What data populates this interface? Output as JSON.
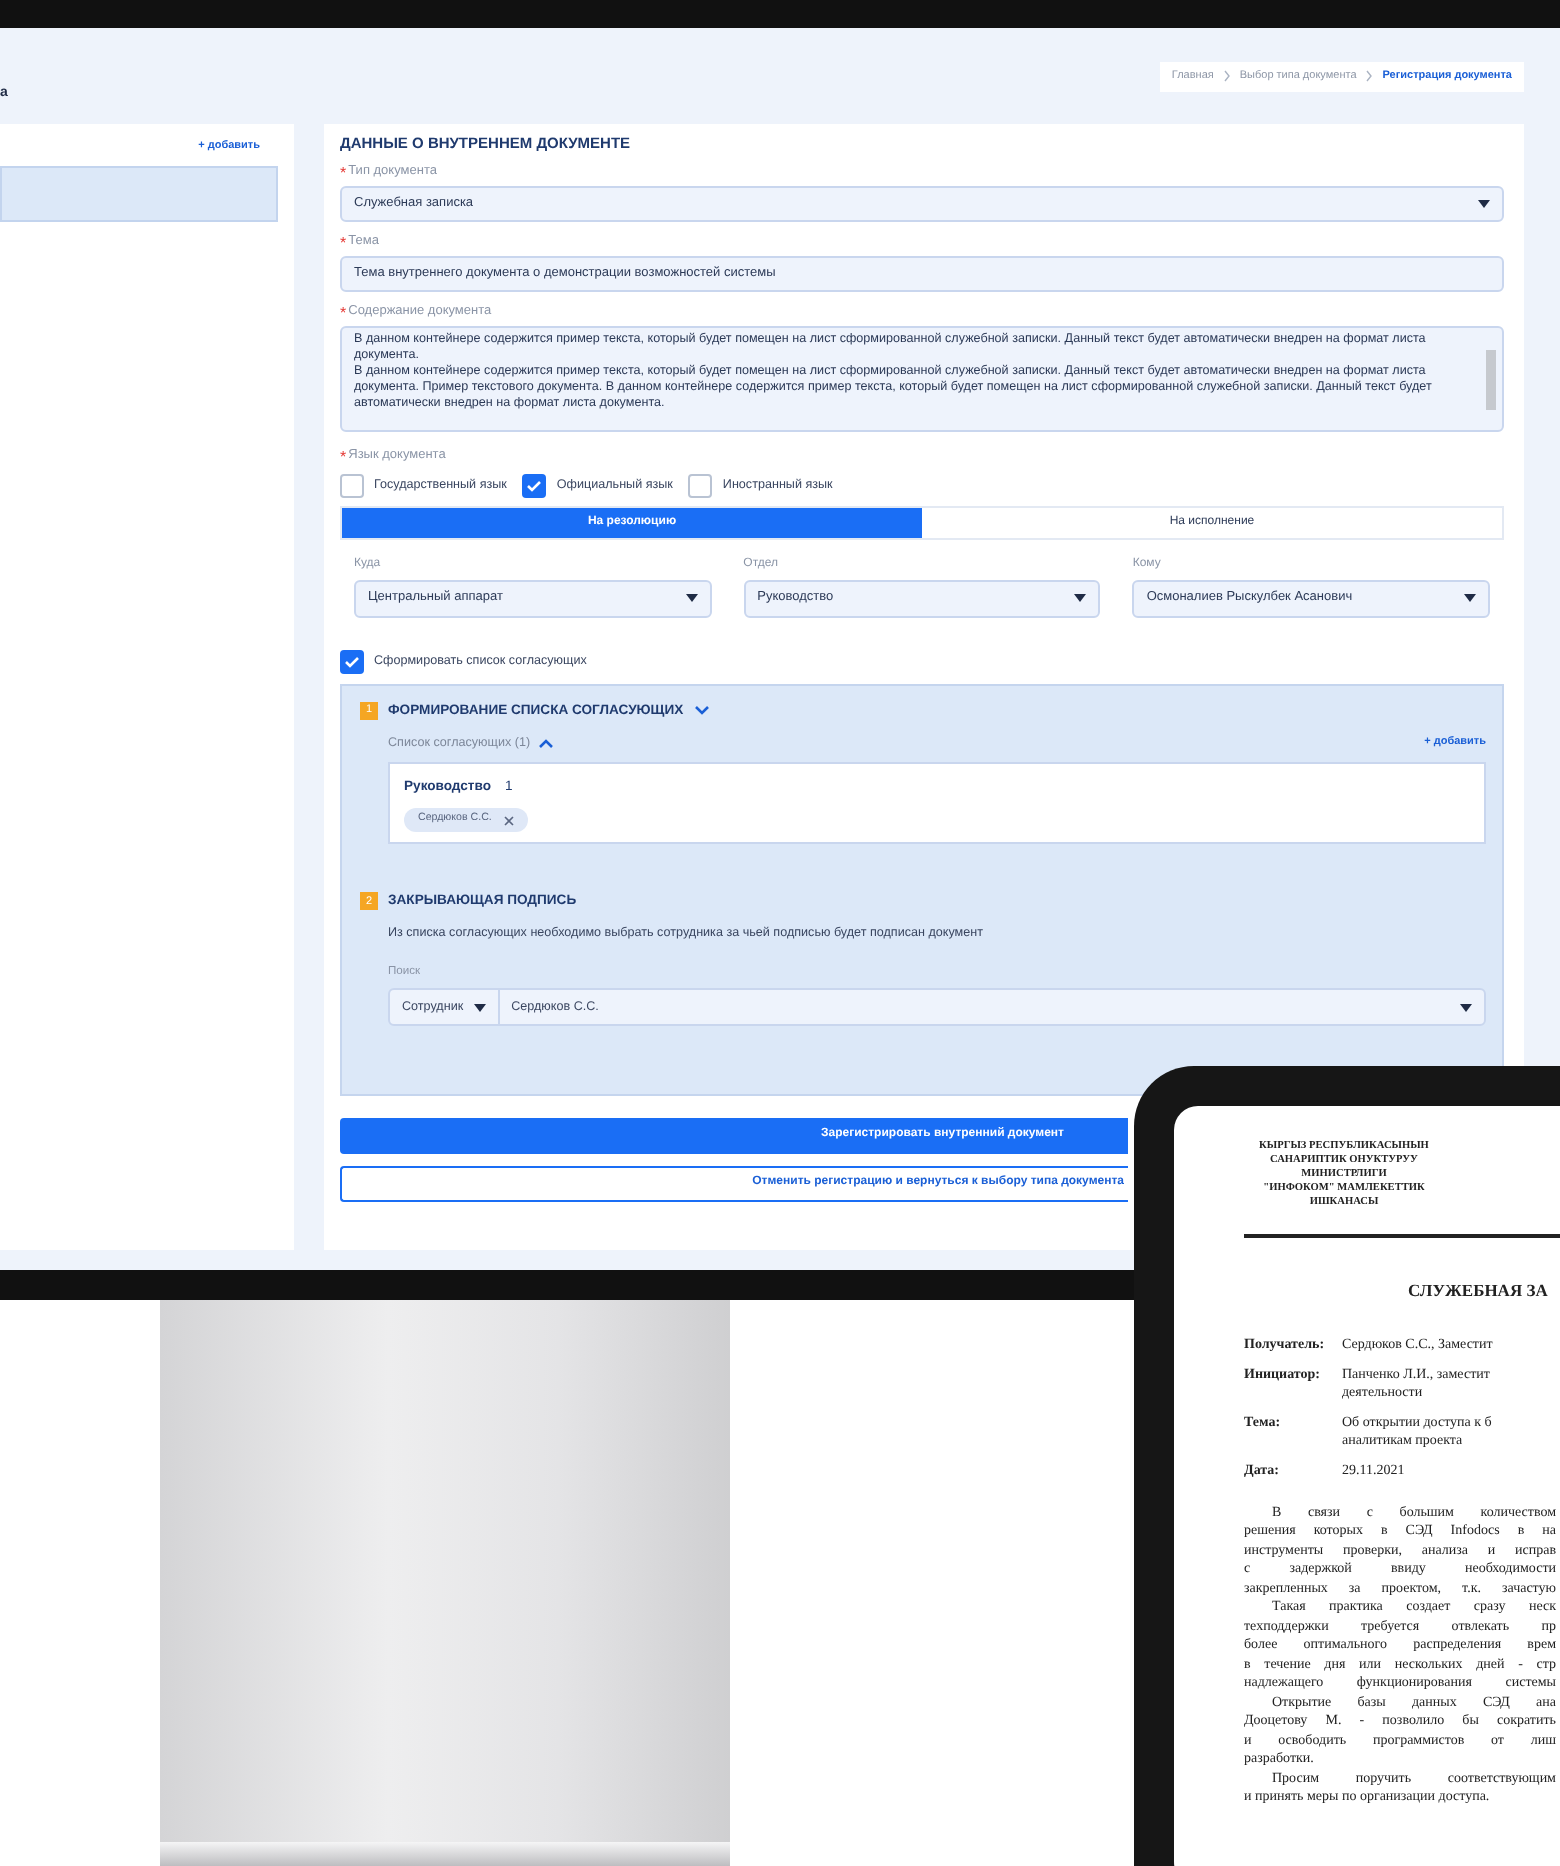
{
  "header": {
    "cut_title": "а",
    "breadcrumbs": [
      {
        "label": "Главная",
        "selected": false
      },
      {
        "label": "Выбор типа документа",
        "selected": false
      },
      {
        "label": "Регистрация документа",
        "selected": true
      }
    ]
  },
  "sidebar": {
    "add_link": "+ добавить",
    "items": [
      {
        "selected": true
      }
    ]
  },
  "form": {
    "title": "ДАННЫЕ О ВНУТРЕННЕМ ДОКУМЕНТЕ",
    "doc_type": {
      "required_mark": "*",
      "label": "Тип документа",
      "value": "Служебная записка"
    },
    "subject": {
      "required_mark": "*",
      "label": "Тема",
      "value": "Тема внутреннего документа о демонстрации возможностей системы"
    },
    "content": {
      "required_mark": "*",
      "label": "Содержание документа",
      "paragraphs": [
        "В данном контейнере содержится пример текста, который будет помещен на лист сформированной служебной записки. Данный текст будет автоматически внедрен на формат листа документа.",
        "В данном контейнере содержится пример текста, который будет помещен на лист сформированной служебной записки. Данный текст будет автоматически внедрен на формат листа документа. Пример текстового документа. В данном контейнере содержится пример текста, который будет помещен на лист сформированной служебной записки. Данный текст будет автоматически внедрен на формат листа документа."
      ]
    },
    "language": {
      "required_mark": "*",
      "label": "Язык документа",
      "options": [
        {
          "label": "Государственный язык",
          "checked": false
        },
        {
          "label": "Официальный язык",
          "checked": true
        },
        {
          "label": "Иностранный язык",
          "checked": false
        }
      ]
    },
    "tabs": [
      {
        "label": "На резолюцию",
        "selected": true
      },
      {
        "label": "На исполнение",
        "selected": false
      }
    ],
    "routing": [
      {
        "label": "Куда",
        "value": "Центральный аппарат"
      },
      {
        "label": "Отдел",
        "value": "Руководство"
      },
      {
        "label": "Кому",
        "value": "Осмоналиев Рыскулбек Асанович"
      }
    ],
    "build_list": {
      "label": "Сформировать список согласующих",
      "checked": true
    },
    "steps": [
      {
        "kind": "approvers",
        "number": "1",
        "title": "ФОРМИРОВАНИЕ СПИСКА СОГЛАСУЮЩИХ",
        "expanded": true,
        "list_label": "Список согласующих (1)",
        "add_link": "+ добавить",
        "group": "Руководство",
        "count": "1",
        "chips": [
          "Сердюков С.С."
        ]
      },
      {
        "kind": "signature",
        "number": "2",
        "title": "ЗАКРЫВАЮЩАЯ ПОДПИСЬ",
        "description": "Из списка согласующих необходимо выбрать сотрудника за чьей подписью будет подписан документ",
        "search_label": "Поиск",
        "filter": "Сотрудник",
        "value": "Сердюков С.С."
      }
    ],
    "buttons": [
      {
        "kind": "primary",
        "label": "Зарегистрировать внутренний документ"
      },
      {
        "kind": "outline",
        "label": "Отменить регистрацию и вернуться к выбору типа документа"
      }
    ]
  },
  "document": {
    "org": [
      "КЫРГЫЗ РЕСПУБЛИКАСЫНЫН",
      "САНАРИПТИК ОНУКТУРУУ",
      "МИНИСТРЛИГИ",
      "\"ИНФОКОМ\" МАМЛЕКЕТТИК",
      "ИШКАНАСЫ"
    ],
    "title": "СЛУЖЕБНАЯ ЗА",
    "fields": [
      {
        "label": "Получатель:",
        "lines": [
          "Сердюков С.С., Заместит"
        ]
      },
      {
        "label": "Инициатор:",
        "lines": [
          "Панченко Л.И., заместит",
          "деятельности"
        ]
      },
      {
        "label": "Тема:",
        "lines": [
          "Об открытии доступа к б",
          "аналитикам проекта"
        ]
      },
      {
        "label": "Дата:",
        "lines": [
          "29.11.2021"
        ]
      }
    ],
    "lines": [
      {
        "kind": "indent",
        "text": "В связи с большим количеством"
      },
      {
        "kind": "line",
        "text": "решения которых в СЭД Infodocs в на"
      },
      {
        "kind": "line",
        "text": "инструменты проверки, анализа и исправ"
      },
      {
        "kind": "line",
        "text": "с задержкой ввиду необходимости"
      },
      {
        "kind": "line",
        "text": "закрепленных за проектом, т.к. зачастую"
      },
      {
        "kind": "indent",
        "text": "Такая практика создает сразу неск"
      },
      {
        "kind": "line",
        "text": "техподдержки требуется отвлекать пр"
      },
      {
        "kind": "line",
        "text": "более оптимального распределения врем"
      },
      {
        "kind": "line",
        "text": "в течение дня или нескольких дней - стр"
      },
      {
        "kind": "line",
        "text": "надлежащего функционирования системы"
      },
      {
        "kind": "indent",
        "text": "Открытие базы данных СЭД ана"
      },
      {
        "kind": "line",
        "text": "Дооцетову М. - позволило бы сократить"
      },
      {
        "kind": "line",
        "text": "и освободить программистов от лиш"
      },
      {
        "kind": "end",
        "text": "разработки."
      },
      {
        "kind": "indent",
        "text": "Просим поручить соответствующим"
      },
      {
        "kind": "end",
        "text": "и принять меры по организации доступа."
      }
    ]
  }
}
